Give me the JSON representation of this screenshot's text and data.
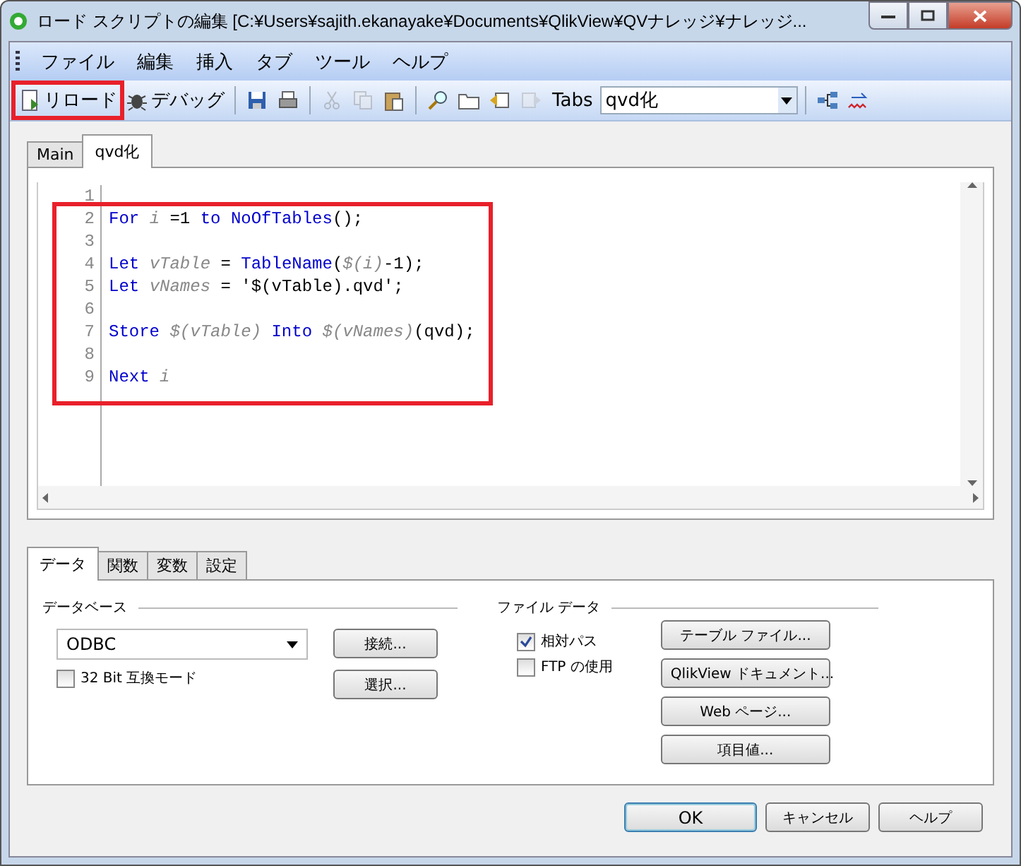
{
  "window": {
    "title": "ロード スクリプトの編集 [C:¥Users¥sajith.ekanayake¥Documents¥QlikView¥QVナレッジ¥ナレッジ..."
  },
  "menu": [
    "ファイル",
    "編集",
    "挿入",
    "タブ",
    "ツール",
    "ヘルプ"
  ],
  "toolbar": [
    {
      "kind": "button",
      "label": "リロード",
      "highlighted": true
    },
    {
      "kind": "button",
      "label": "デバッグ",
      "highlighted": false
    },
    {
      "kind": "sep"
    },
    {
      "kind": "icon",
      "disabled": false
    },
    {
      "kind": "icon",
      "disabled": false
    },
    {
      "kind": "sep"
    },
    {
      "kind": "icon",
      "disabled": true
    },
    {
      "kind": "icon",
      "disabled": true
    },
    {
      "kind": "icon",
      "disabled": false
    },
    {
      "kind": "sep"
    },
    {
      "kind": "icon",
      "disabled": false
    },
    {
      "kind": "icon",
      "disabled": false
    },
    {
      "kind": "icon",
      "disabled": false
    },
    {
      "kind": "icon",
      "disabled": true
    },
    {
      "kind": "label",
      "label": "Tabs"
    },
    {
      "kind": "dropdown",
      "value": "qvd化"
    },
    {
      "kind": "sep"
    },
    {
      "kind": "icon",
      "disabled": false
    },
    {
      "kind": "icon",
      "disabled": false
    }
  ],
  "script_tabs": [
    {
      "label": "Main",
      "selected": false
    },
    {
      "label": "qvd化",
      "selected": true
    }
  ],
  "editor": {
    "highlighted": true,
    "lines": [
      {
        "number": "1"
      },
      {
        "number": "2",
        "tokens": [
          {
            "kind": "kw",
            "text": "For "
          },
          {
            "kind": "var",
            "text": "i"
          },
          {
            "kind": "plain",
            "text": " =1 "
          },
          {
            "kind": "kw",
            "text": "to "
          },
          {
            "kind": "kw",
            "text": "NoOfTables"
          },
          {
            "kind": "plain",
            "text": "();"
          }
        ]
      },
      {
        "number": "3"
      },
      {
        "number": "4",
        "tokens": [
          {
            "kind": "kw",
            "text": "Let "
          },
          {
            "kind": "var",
            "text": "vTable"
          },
          {
            "kind": "plain",
            "text": " = "
          },
          {
            "kind": "kw",
            "text": "TableName"
          },
          {
            "kind": "plain",
            "text": "("
          },
          {
            "kind": "var",
            "text": "$(i)"
          },
          {
            "kind": "plain",
            "text": "-1);"
          }
        ]
      },
      {
        "number": "5",
        "tokens": [
          {
            "kind": "kw",
            "text": "Let "
          },
          {
            "kind": "var",
            "text": "vNames"
          },
          {
            "kind": "plain",
            "text": " = '$(vTable).qvd';"
          }
        ]
      },
      {
        "number": "6"
      },
      {
        "number": "7",
        "tokens": [
          {
            "kind": "kw",
            "text": "Store "
          },
          {
            "kind": "var",
            "text": "$(vTable) "
          },
          {
            "kind": "kw",
            "text": "Into "
          },
          {
            "kind": "var",
            "text": "$(vNames)"
          },
          {
            "kind": "plain",
            "text": "(qvd);"
          }
        ]
      },
      {
        "number": "8"
      },
      {
        "number": "9",
        "tokens": [
          {
            "kind": "kw",
            "text": "Next "
          },
          {
            "kind": "var",
            "text": "i"
          }
        ]
      }
    ]
  },
  "bottom_tabs": [
    {
      "label": "データ",
      "selected": true
    },
    {
      "label": "関数",
      "selected": false
    },
    {
      "label": "変数",
      "selected": false
    },
    {
      "label": "設定",
      "selected": false
    }
  ],
  "database": {
    "title": "データベース",
    "select": "ODBC",
    "buttons": [
      "接続...",
      "選択..."
    ],
    "checkbox": {
      "label": "32 Bit 互換モード",
      "checked": false
    }
  },
  "file_data": {
    "title": "ファイル データ",
    "checkboxes": [
      {
        "label": "相対パス",
        "checked": true
      },
      {
        "label": "FTP の使用",
        "checked": false
      }
    ],
    "buttons": [
      "テーブル ファイル...",
      "QlikView ドキュメント...",
      "Web ページ...",
      "項目値..."
    ]
  },
  "buttons": [
    {
      "label": "OK",
      "default": true
    },
    {
      "label": "キャンセル",
      "default": false
    },
    {
      "label": "ヘルプ",
      "default": false
    }
  ]
}
